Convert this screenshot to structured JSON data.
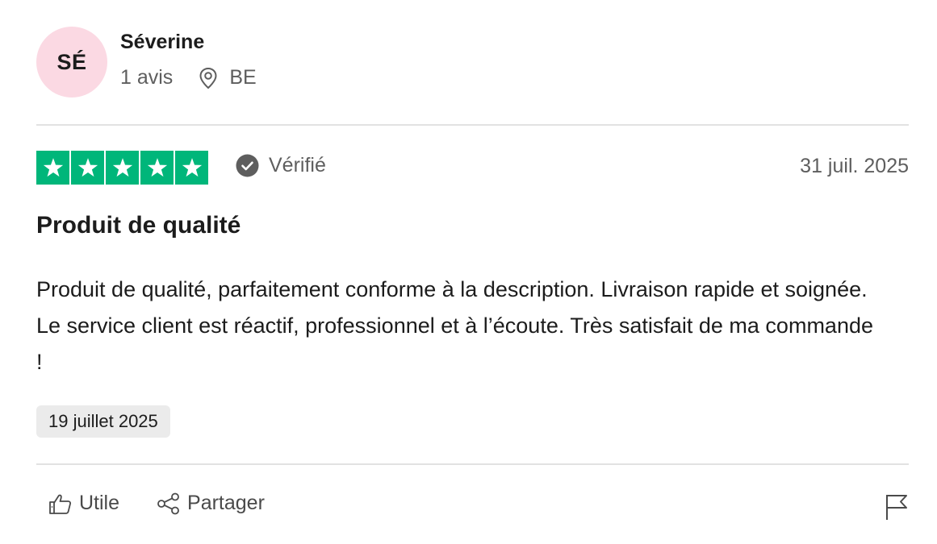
{
  "author": {
    "initials": "SÉ",
    "name": "Séverine",
    "reviews_count": "1 avis",
    "country": "BE"
  },
  "review": {
    "rating": 5,
    "rating_max": 5,
    "verified_label": "Vérifié",
    "published_date": "31 juil. 2025",
    "title": "Produit de qualité",
    "body": "Produit de qualité, parfaitement conforme à la description. Livraison rapide et soignée. Le service client est réactif, professionnel et à l’écoute. Très satisfait de ma commande !",
    "experience_date": "19 juillet 2025"
  },
  "actions": {
    "useful_label": "Utile",
    "share_label": "Partager"
  },
  "colors": {
    "star_green": "#00b67a",
    "avatar_bg": "#fbd9e3",
    "muted_text": "#5e5e5e"
  },
  "icons": {
    "location": "location-pin-icon",
    "verified": "check-circle-icon",
    "useful": "thumbs-up-icon",
    "share": "share-icon",
    "report": "flag-icon"
  }
}
